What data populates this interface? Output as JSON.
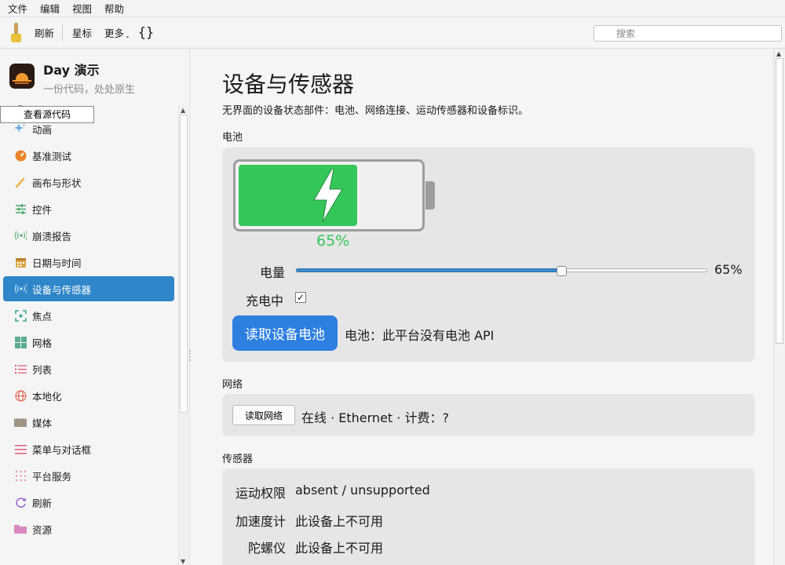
{
  "menubar": [
    "文件",
    "编辑",
    "视图",
    "帮助"
  ],
  "toolbar": {
    "refresh": "刷新",
    "star": "星标",
    "more": "更多",
    "caret": "⌄",
    "braces": "{}",
    "search_placeholder": "搜索"
  },
  "app": {
    "title": "Day 演示",
    "subtitle": "一份代码，处处原生",
    "view_source": "查看源代码"
  },
  "sidebar": {
    "items": [
      {
        "label": "",
        "icon": "circle-icon"
      },
      {
        "label": "动画",
        "icon": "sparkle-icon"
      },
      {
        "label": "基准测试",
        "icon": "gauge-icon"
      },
      {
        "label": "画布与形状",
        "icon": "brush-icon"
      },
      {
        "label": "控件",
        "icon": "sliders-icon"
      },
      {
        "label": "崩溃报告",
        "icon": "broadcast-icon"
      },
      {
        "label": "日期与时间",
        "icon": "calendar-icon"
      },
      {
        "label": "设备与传感器",
        "icon": "broadcast-icon",
        "active": true
      },
      {
        "label": "焦点",
        "icon": "focus-icon"
      },
      {
        "label": "网格",
        "icon": "grid-icon"
      },
      {
        "label": "列表",
        "icon": "list-icon"
      },
      {
        "label": "本地化",
        "icon": "globe-icon"
      },
      {
        "label": "媒体",
        "icon": "media-icon"
      },
      {
        "label": "菜单与对话框",
        "icon": "menu-icon"
      },
      {
        "label": "平台服务",
        "icon": "dots-grid-icon"
      },
      {
        "label": "刷新",
        "icon": "refresh-icon"
      },
      {
        "label": "资源",
        "icon": "folder-icon"
      }
    ]
  },
  "page": {
    "title": "设备与传感器",
    "description": "无界面的设备状态部件：电池、网络连接、运动传感器和设备标识。"
  },
  "battery": {
    "section": "电池",
    "percent": 65,
    "percent_text": "65%",
    "level_label": "电量",
    "level_value": "65%",
    "charging_label": "充电中",
    "charging": true,
    "check_mark": "✓",
    "read_button": "读取设备电池",
    "status": "电池：此平台没有电池 API",
    "fill_color": "#34c659"
  },
  "network": {
    "section": "网络",
    "read_button": "读取网络",
    "status": "在线 · Ethernet · 计费：?"
  },
  "sensors": {
    "section": "传感器",
    "rows": [
      {
        "key": "运动权限",
        "value": "absent / unsupported"
      },
      {
        "key": "加速度计",
        "value": "此设备上不可用"
      },
      {
        "key": "陀螺仪",
        "value": "此设备上不可用"
      }
    ]
  },
  "colors": {
    "accent": "#2f86c8",
    "button_primary": "#2d7fe0"
  }
}
